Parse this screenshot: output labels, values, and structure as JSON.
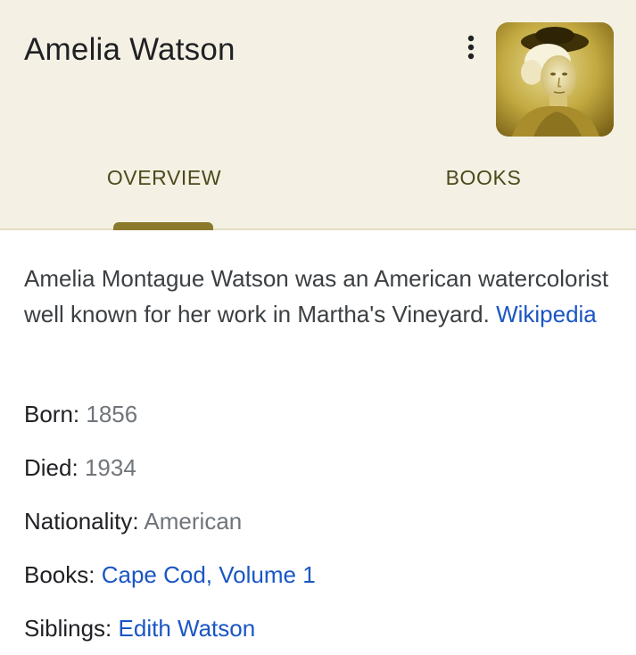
{
  "header": {
    "title": "Amelia Watson",
    "more_icon": "more-vert-icon",
    "thumbnail": "portrait-of-amelia-watson"
  },
  "tabs": [
    {
      "label": "OVERVIEW",
      "selected": true
    },
    {
      "label": "BOOKS",
      "selected": false
    }
  ],
  "overview": {
    "description": "Amelia Montague Watson was an American watercolorist well known for her work in Martha's Vineyard.",
    "source_link": "Wikipedia",
    "facts": [
      {
        "label": "Born:",
        "value": "1856",
        "is_link": false
      },
      {
        "label": "Died:",
        "value": "1934",
        "is_link": false
      },
      {
        "label": "Nationality:",
        "value": "American",
        "is_link": false
      },
      {
        "label": "Books:",
        "value": "Cape Cod, Volume 1",
        "is_link": true
      },
      {
        "label": "Siblings:",
        "value": "Edith Watson",
        "is_link": true
      }
    ]
  },
  "colors": {
    "header_bg": "#f4f1e4",
    "tab_text": "#4d4a1c",
    "tab_indicator": "#8b7a2c",
    "link": "#1a56c4",
    "muted_value": "#70757a"
  }
}
